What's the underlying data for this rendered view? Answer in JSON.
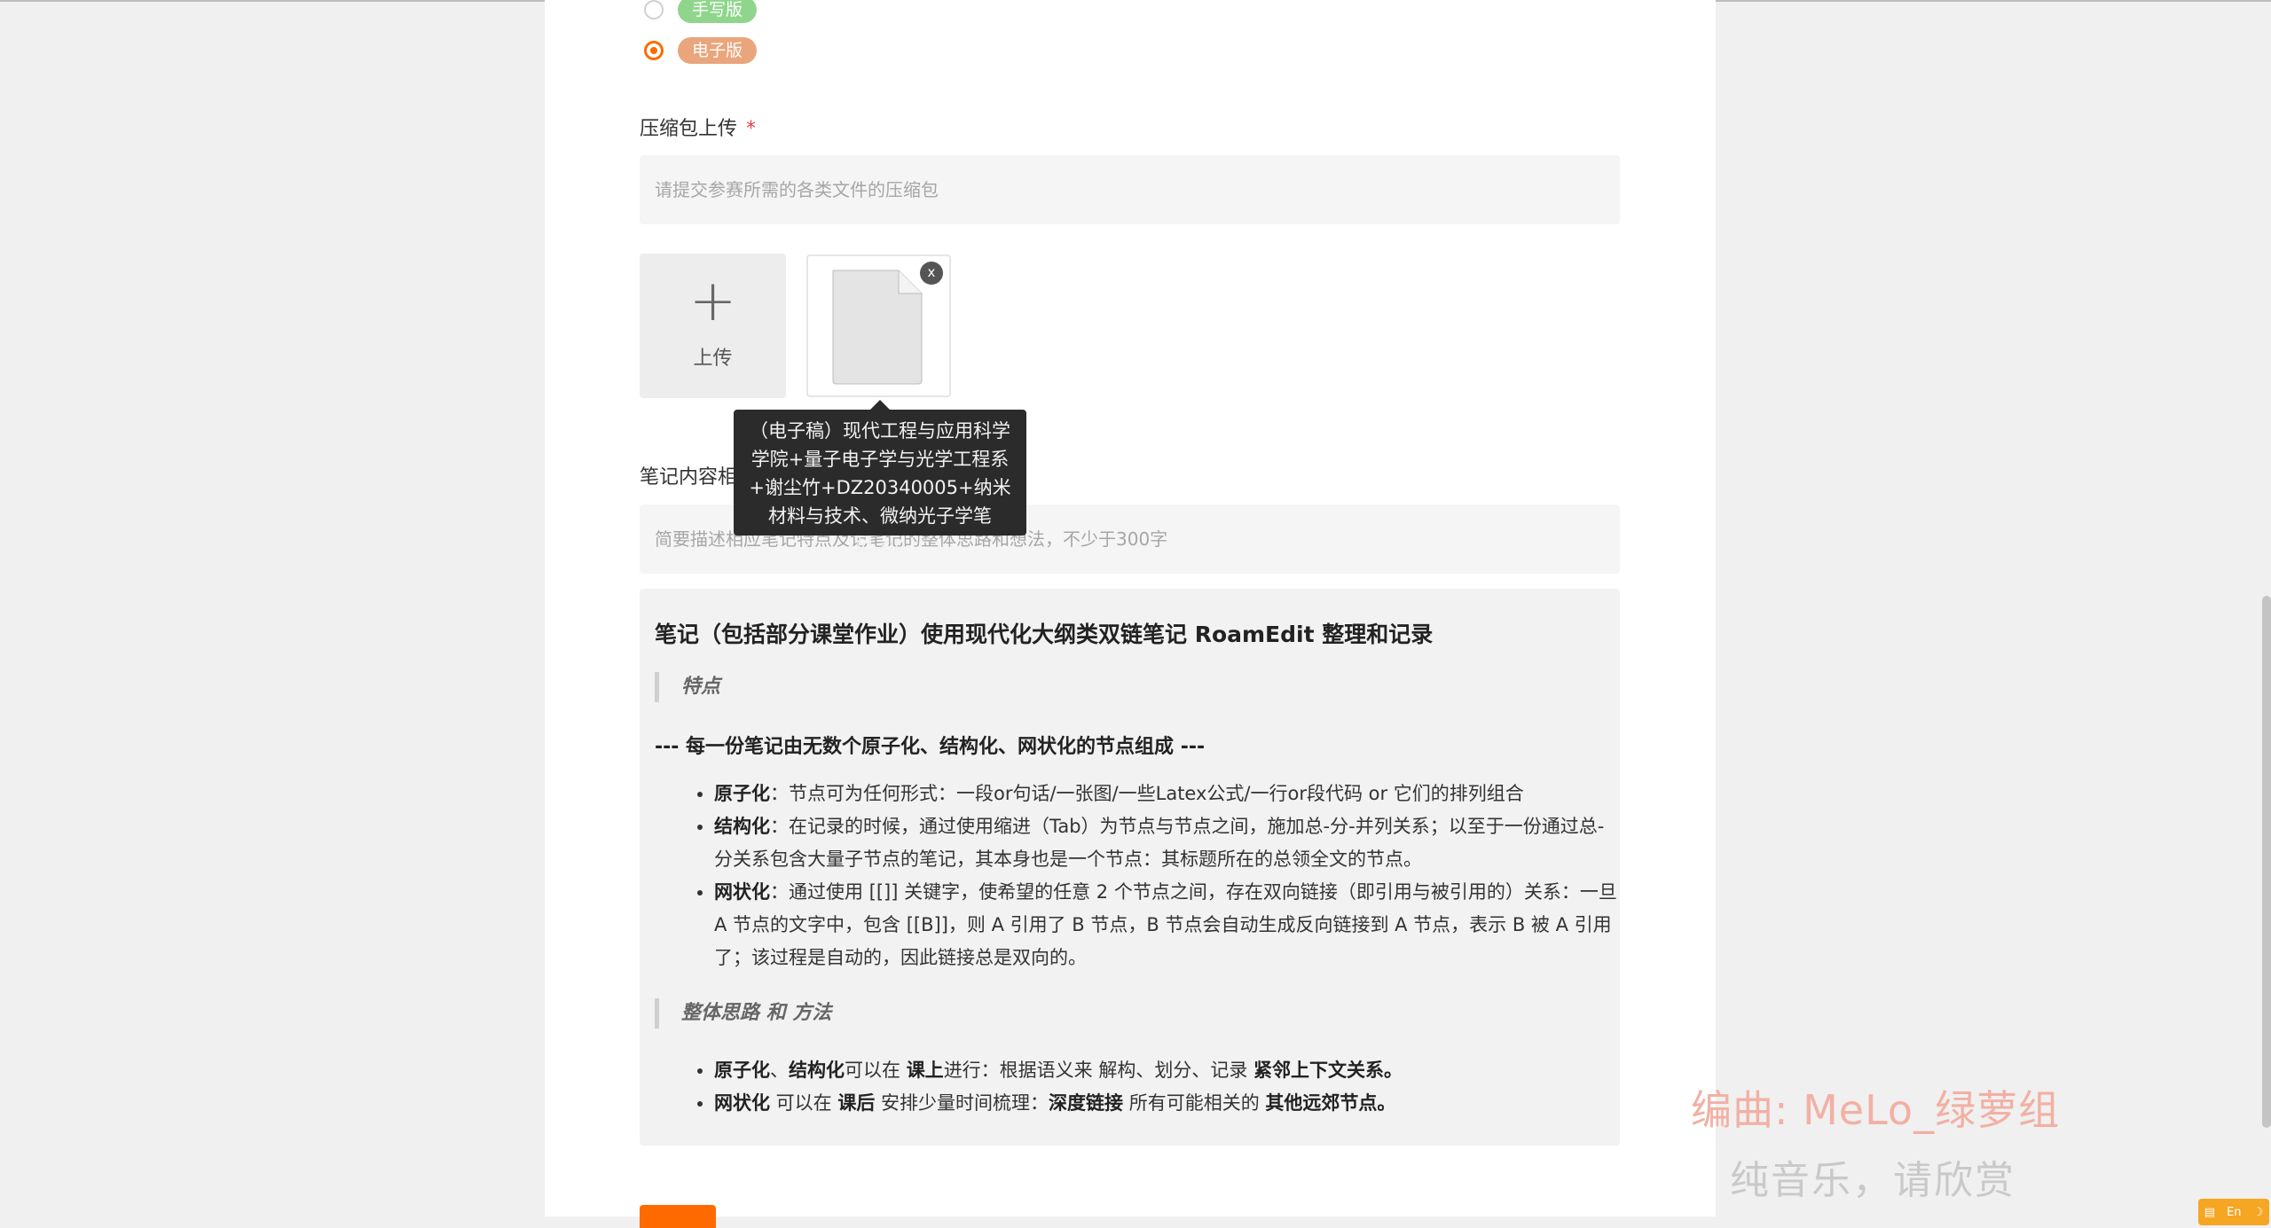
{
  "form": {
    "version_options": [
      {
        "label": "手写版",
        "checked": false,
        "color": "#8fd68c"
      },
      {
        "label": "电子版",
        "checked": true,
        "color": "#e9a57c"
      }
    ],
    "zip_upload": {
      "label": "压缩包上传",
      "required_mark": "*",
      "placeholder": "请提交参赛所需的各类文件的压缩包",
      "upload_plus": "+",
      "upload_label": "上传",
      "file_delete": "x",
      "file_tooltip": "（电子稿）现代工程与应用科学学院+量子电子学与光学工程系+谢尘竹+DZ20340005+纳米材料与技术、微纳光子学笔记.zip"
    },
    "description": {
      "label": "笔记内容相关描述",
      "placeholder": "简要描述相应笔记特点及记笔记的整体思路和想法，不少于300字"
    }
  },
  "content": {
    "heading": "笔记（包括部分课堂作业）使用现代化大纲类双链笔记 RoamEdit 整理和记录",
    "quote1": "特点",
    "subheading": "--- 每一份笔记由无数个原子化、结构化、网状化的节点组成 ---",
    "list1": [
      {
        "term": "原子化",
        "text": "：节点可为任何形式：一段or句话/一张图/一些Latex公式/一行or段代码 or 它们的排列组合"
      },
      {
        "term": "结构化",
        "text": "：在记录的时候，通过使用缩进（Tab）为节点与节点之间，施加总-分-并列关系；以至于一份通过总-分关系包含大量子节点的笔记，其本身也是一个节点：其标题所在的总领全文的节点。"
      },
      {
        "term": "网状化",
        "text": "：通过使用 [[]] 关键字，使希望的任意 2 个节点之间，存在双向链接（即引用与被引用的）关系：一旦 A 节点的文字中，包含 [[B]]，则 A 引用了 B 节点，B 节点会自动生成反向链接到 A 节点，表示 B 被 A 引用了；该过程是自动的，因此链接总是双向的。"
      }
    ],
    "quote2": "整体思路 和 方法",
    "list2a": {
      "b1": "原子化",
      "t1": "、",
      "b2": "结构化",
      "t2": "可以在 ",
      "b3": "课上",
      "t3": "进行：根据语义来 解构、划分、记录 ",
      "b4": "紧邻上下文关系。"
    },
    "list2b": {
      "b1": "网状化",
      "t1": " 可以在 ",
      "b2": "课后",
      "t2": " 安排少量时间梳理：",
      "b3": "深度链接",
      "t3": " 所有可能相关的 ",
      "b4": "其他远郊节点。"
    }
  },
  "overlay": {
    "watermark_line1": "编曲: MeLo_绿萝组",
    "watermark_line2": "纯音乐，请欣赏",
    "tray_label": "En"
  },
  "colors": {
    "accent": "#ff6a00",
    "required": "#e64340"
  }
}
